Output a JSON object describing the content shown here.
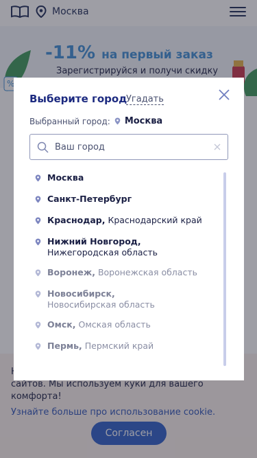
{
  "header": {
    "city": "Москва"
  },
  "promo": {
    "headline": "-11%",
    "headline_tail": "на первый заказ",
    "subtitle": "Зарегистрируйся и получи скидку"
  },
  "cookie": {
    "text": "Н... сайтов. Мы используем куки для вашего комфорта!",
    "text_line1": "Н",
    "text_line2": "сайтов. Мы используем куки для вашего",
    "text_line3": "комфорта!",
    "link": "Узнайте больше про использование cookie.",
    "agree_label": "Согласен"
  },
  "modal": {
    "title": "Выберите город",
    "guess_label": "Угадать",
    "selected_label": "Выбранный город:",
    "selected_city": "Москва",
    "search": {
      "placeholder": "Ваш город",
      "value": ""
    },
    "cities": [
      {
        "name": "Москва",
        "region": ""
      },
      {
        "name": "Санкт-Петербург",
        "region": ""
      },
      {
        "name": "Краснодар,",
        "region": "Краснодарский край"
      },
      {
        "name": "Нижний Новгород,",
        "region": "Нижегородская область"
      },
      {
        "name": "Воронеж,",
        "region": "Воронежская область"
      },
      {
        "name": "Новосибирск,",
        "region": "Новосибирская область"
      },
      {
        "name": "Омск,",
        "region": "Омская область"
      },
      {
        "name": "Пермь,",
        "region": "Пермский край"
      }
    ]
  },
  "colors": {
    "accent": "#2f5fc8",
    "title": "#1c2a80",
    "promo": "#3e8fd6",
    "scrollbar": "#c8cdea"
  }
}
